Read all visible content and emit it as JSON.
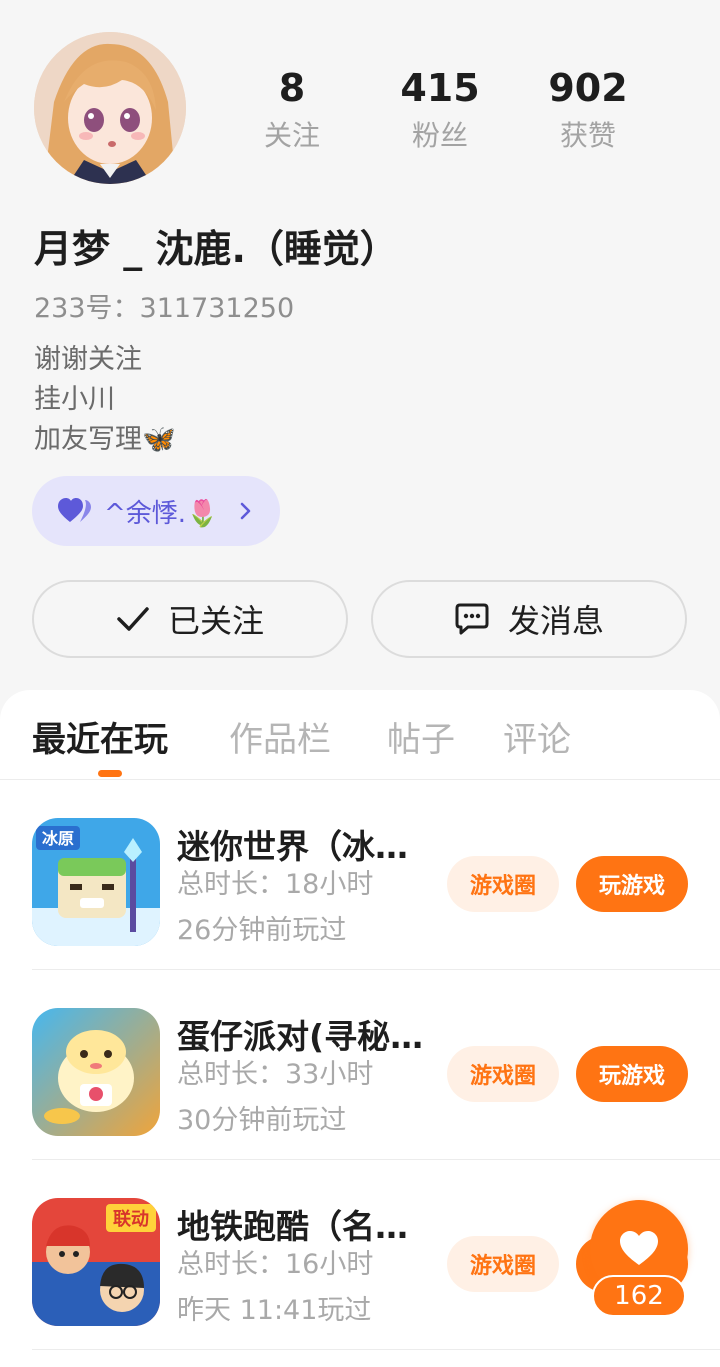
{
  "profile": {
    "stats": [
      {
        "value": "8",
        "label": "关注"
      },
      {
        "value": "415",
        "label": "粉丝"
      },
      {
        "value": "902",
        "label": "获赞"
      }
    ],
    "username": "月梦 _ 沈鹿.（睡觉）",
    "uid": "233号：311731250",
    "bio": [
      "谢谢关注",
      "挂小川",
      "加友写理🦋"
    ],
    "tag": {
      "icon": "double-heart-icon",
      "text": "^余悸.🌷"
    },
    "follow_button": "已关注",
    "message_button": "发消息"
  },
  "tabs": [
    "最近在玩",
    "作品栏",
    "帖子",
    "评论"
  ],
  "active_tab": "最近在玩",
  "games": [
    {
      "name": "迷你世界（冰…",
      "duration": "总时长：18小时",
      "last_played": "26分钟前玩过",
      "circle_label": "游戏圈",
      "play_label": "玩游戏"
    },
    {
      "name": "蛋仔派对(寻秘…",
      "duration": "总时长：33小时",
      "last_played": "30分钟前玩过",
      "circle_label": "游戏圈",
      "play_label": "玩游戏"
    },
    {
      "name": "地铁跑酷（名…",
      "duration": "总时长：16小时",
      "last_played": "昨天 11:41玩过",
      "circle_label": "游戏圈",
      "play_label": "玩游戏"
    }
  ],
  "like_fab": {
    "icon": "heart-icon",
    "count": "162"
  },
  "colors": {
    "accent": "#ff7413",
    "accent_light": "#fff0e5",
    "tag_bg": "#e5e4fb",
    "tag_fg": "#5d59d9"
  }
}
